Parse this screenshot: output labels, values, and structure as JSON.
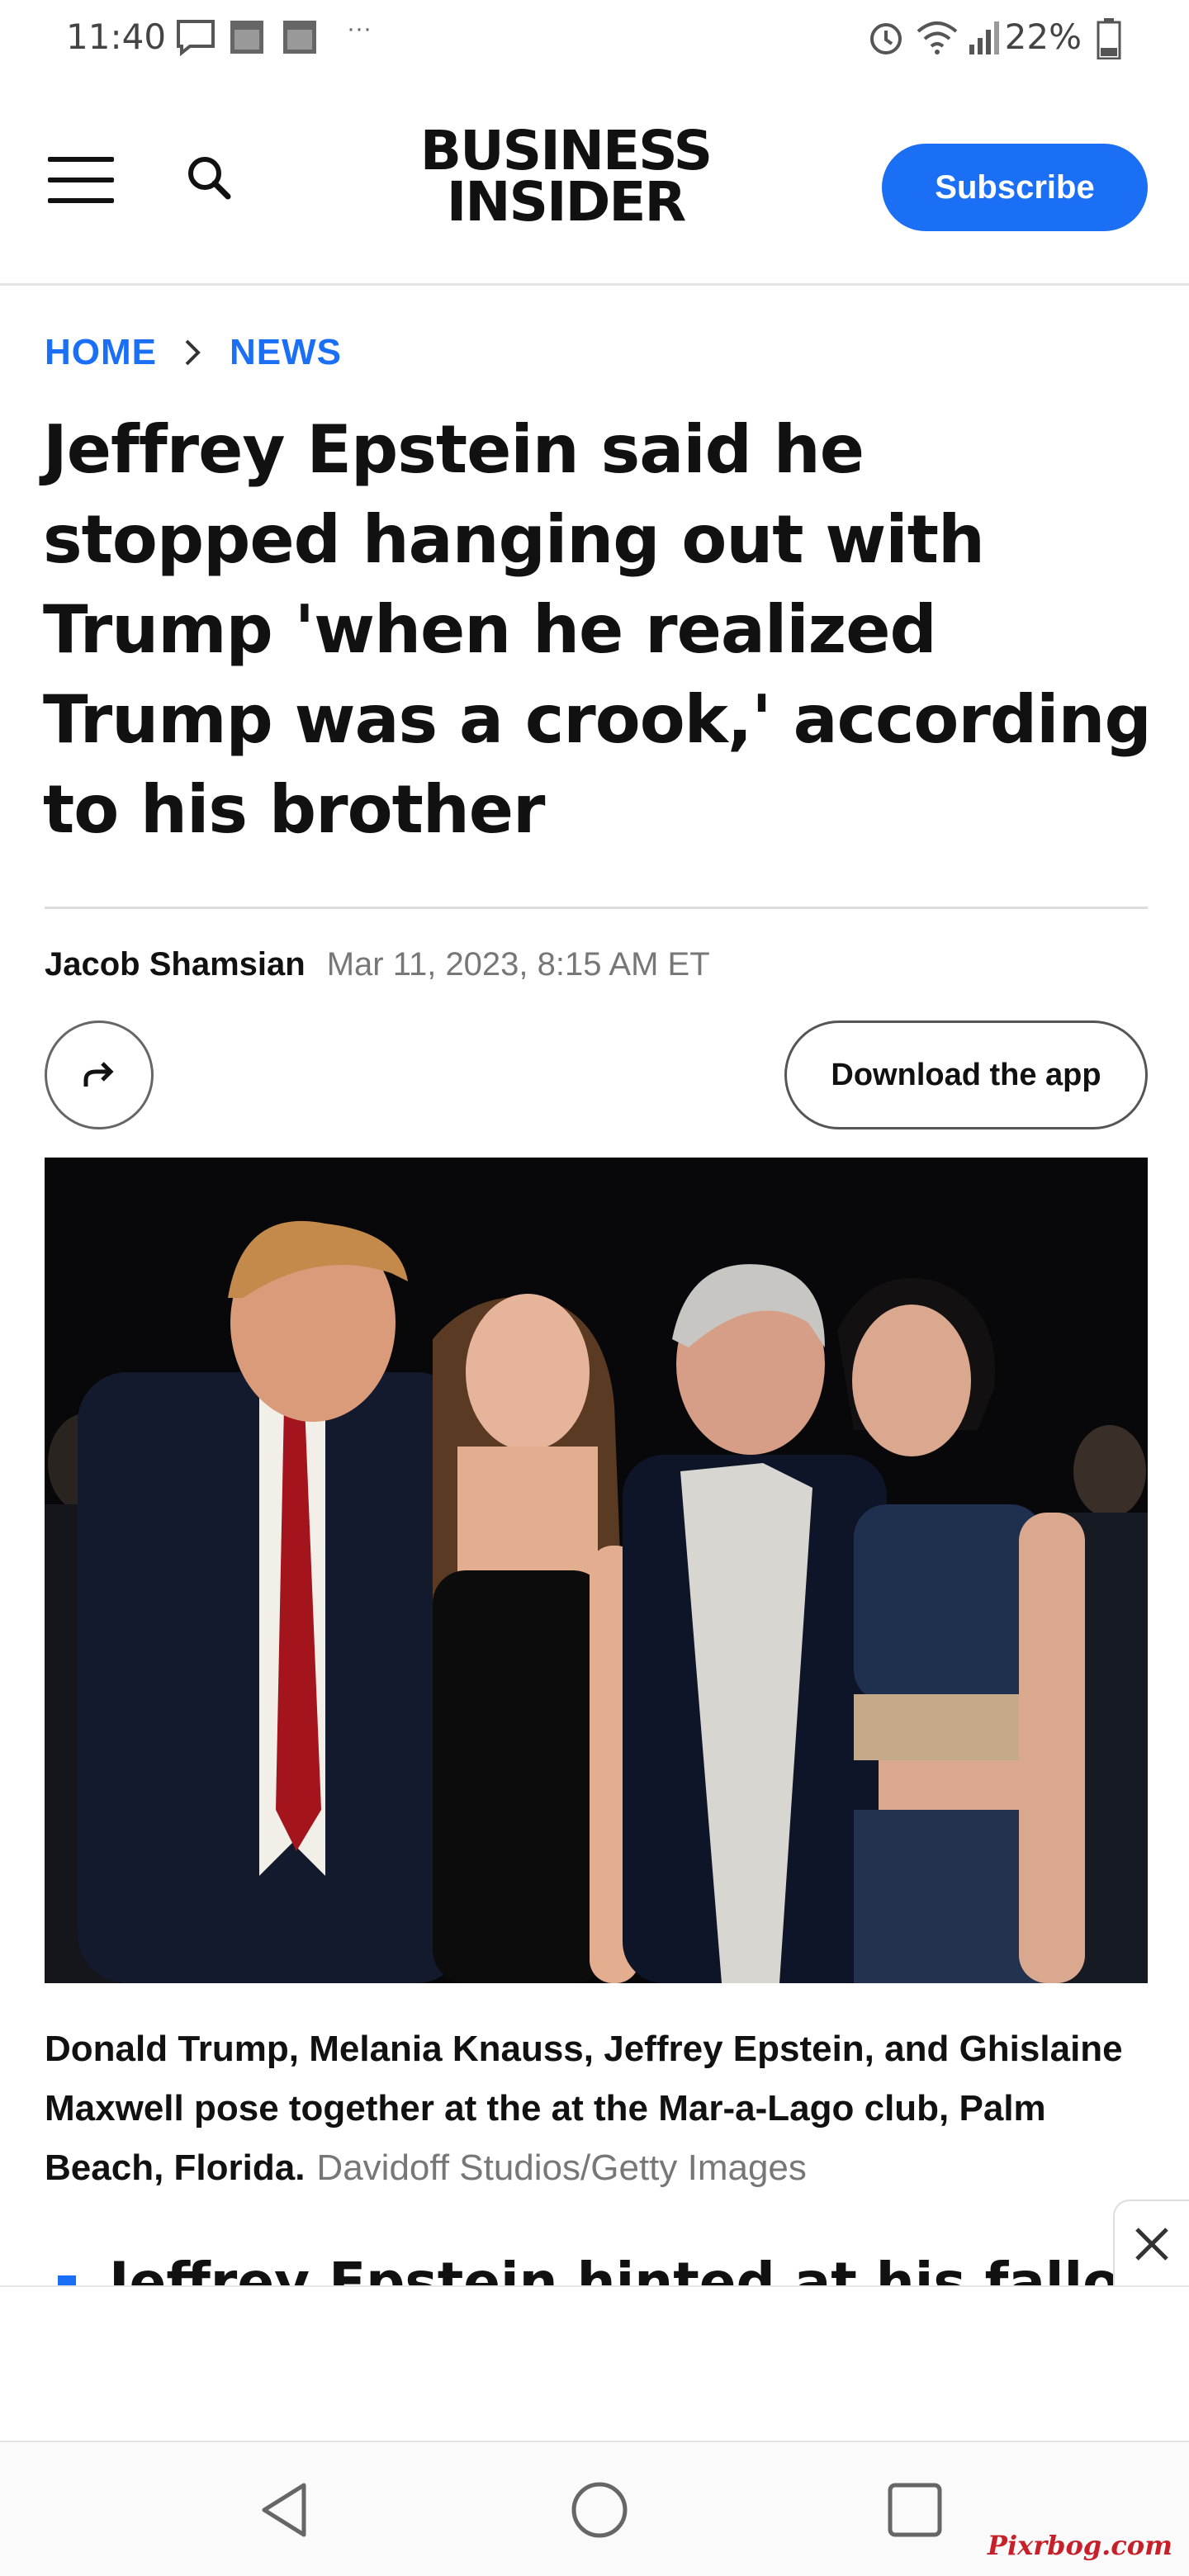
{
  "status_bar": {
    "time": "11:40",
    "dots": "···",
    "battery_percent": "22%",
    "icons": [
      "message-icon",
      "calendar-icon",
      "calendar-icon",
      "alarm-icon",
      "wifi-icon",
      "signal-icon",
      "battery-icon"
    ]
  },
  "header": {
    "logo_line1": "BUSINESS",
    "logo_line2": "INSIDER",
    "subscribe_label": "Subscribe",
    "icons": [
      "menu-icon",
      "search-icon"
    ]
  },
  "breadcrumb": {
    "items": [
      "HOME",
      "NEWS"
    ]
  },
  "article": {
    "headline": "Jeffrey Epstein said he stopped hanging out with Trump 'when he realized Trump was a crook,' according to his brother",
    "author": "Jacob Shamsian",
    "date": "Mar 11, 2023, 8:15 AM ET",
    "download_label": "Download the app",
    "caption": "Donald Trump, Melania Knauss, Jeffrey Epstein, and Ghislaine Maxwell pose together at the at the Mar-a-Lago club, Palm Beach, Florida.",
    "credit": "Davidoff Studios/Getty Images",
    "bullet_partial": "Jeffrey Epstein hinted at his fallout with"
  },
  "colors": {
    "accent": "#1a6ff5",
    "text": "#111111",
    "muted": "#777777"
  },
  "watermark": "Pixrbog.com"
}
